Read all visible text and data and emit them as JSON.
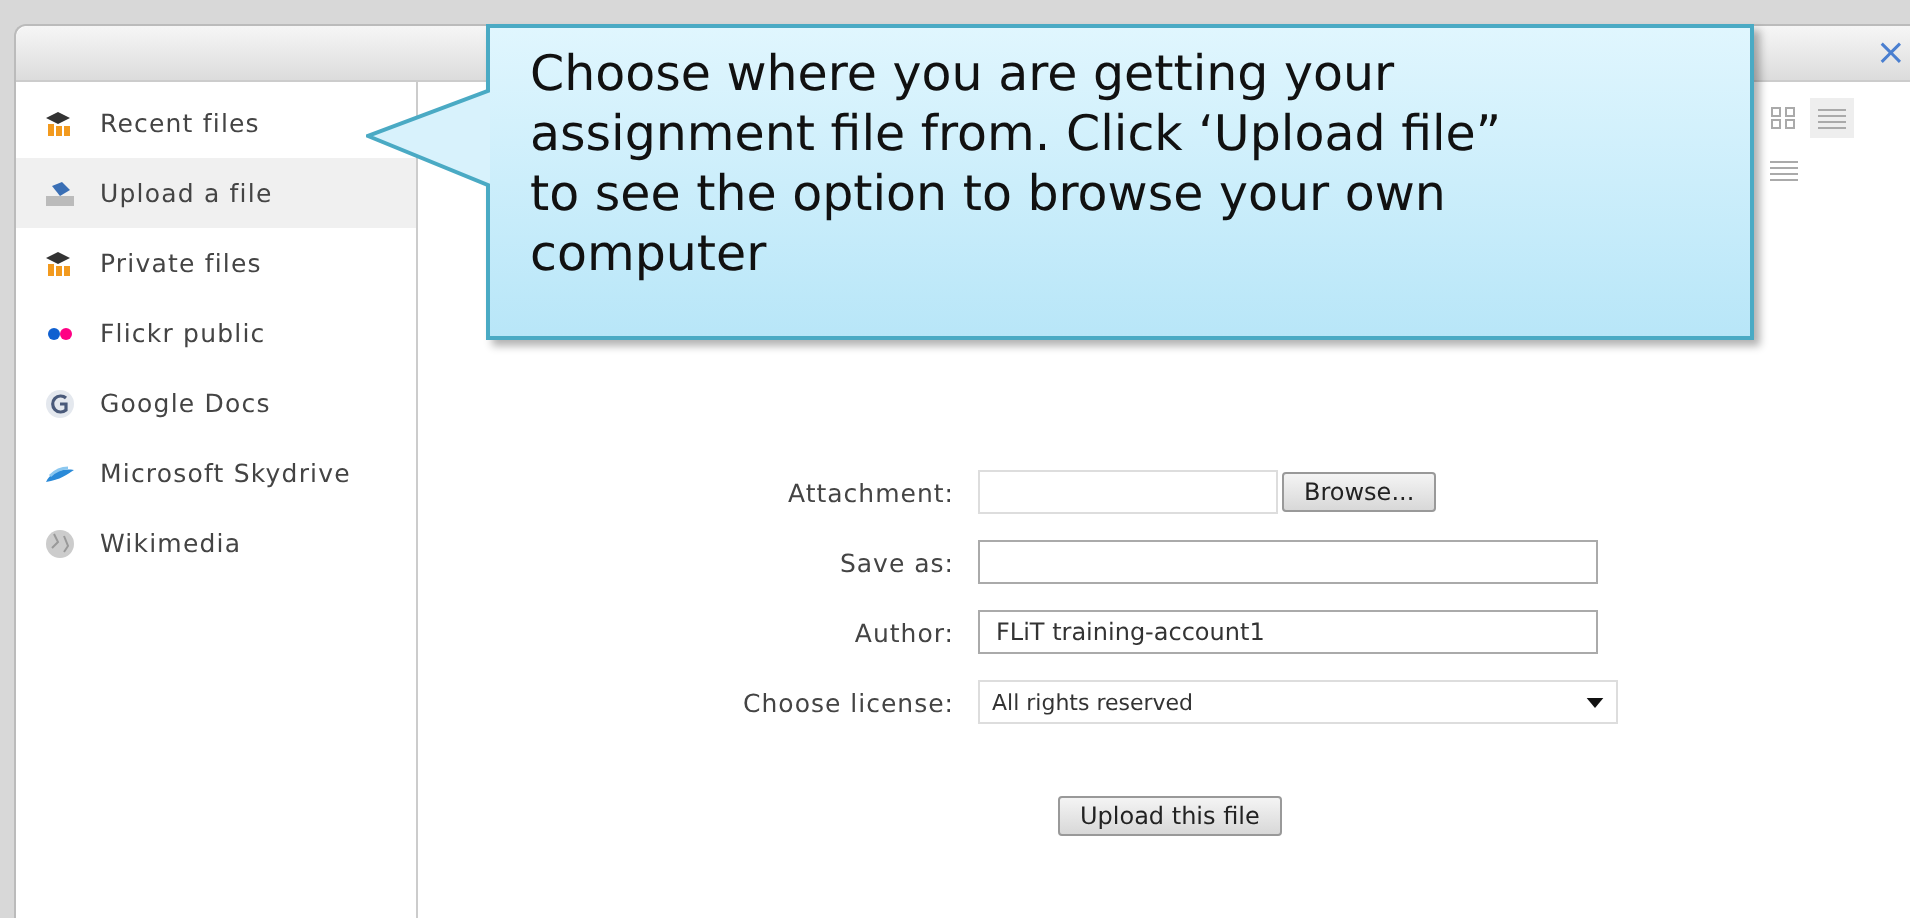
{
  "dialog": {
    "close": "×"
  },
  "sidebar": {
    "items": [
      {
        "label": "Recent files",
        "kind": "moodle",
        "selected": false
      },
      {
        "label": "Upload a file",
        "kind": "upload",
        "selected": true
      },
      {
        "label": "Private files",
        "kind": "moodle",
        "selected": false
      },
      {
        "label": "Flickr public",
        "kind": "flickr",
        "selected": false
      },
      {
        "label": "Google Docs",
        "kind": "google",
        "selected": false
      },
      {
        "label": "Microsoft Skydrive",
        "kind": "cloud",
        "selected": false
      },
      {
        "label": "Wikimedia",
        "kind": "globe",
        "selected": false
      }
    ]
  },
  "form": {
    "attachment": {
      "label": "Attachment:",
      "button": "Browse..."
    },
    "save_as": {
      "label": "Save as:"
    },
    "author": {
      "label": "Author:",
      "value": "FLiT training-account1"
    },
    "license": {
      "label": "Choose license:",
      "value": "All rights reserved"
    },
    "submit": "Upload this file"
  },
  "callout": {
    "text": "Choose where you are getting your assignment file from. Click ‘Upload file” to see the option to browse your own computer"
  }
}
